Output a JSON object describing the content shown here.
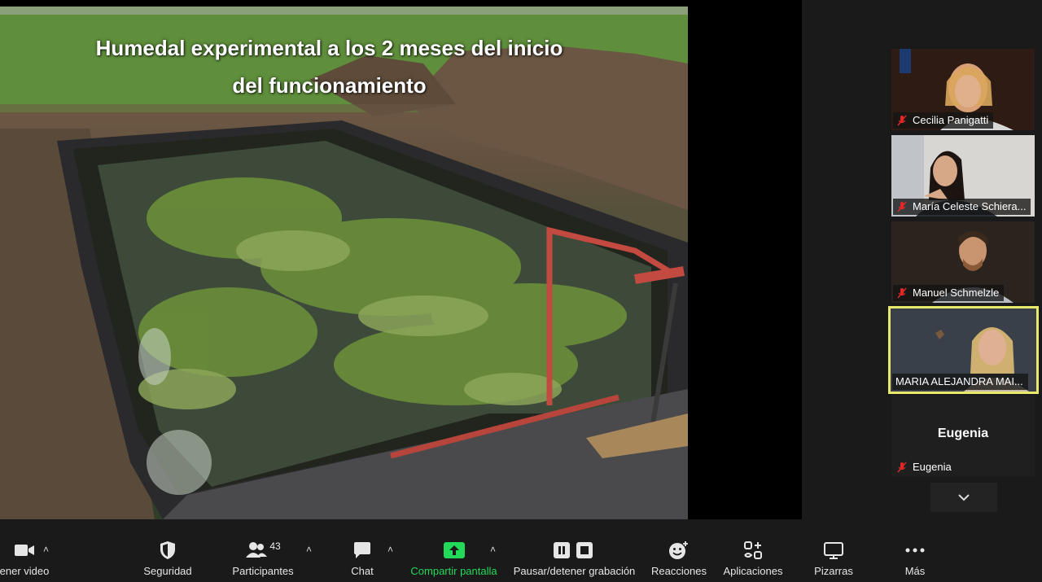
{
  "slide": {
    "title_line1": "Humedal experimental a los 2 meses del inicio",
    "title_line2": "del funcionamiento"
  },
  "participants": [
    {
      "name": "Cecilia Panigatti",
      "muted": true
    },
    {
      "name": "María Celeste Schiera...",
      "muted": true
    },
    {
      "name": "Manuel Schmelzle",
      "muted": true
    },
    {
      "name": "MARIA ALEJANDRA MAI...",
      "muted": false,
      "active_speaker": true
    },
    {
      "name": "Eugenia",
      "display": "Eugenia",
      "muted": true
    }
  ],
  "toolbar": {
    "video": "ener video",
    "security": "Seguridad",
    "participants": "Participantes",
    "participants_count": "43",
    "chat": "Chat",
    "share": "Compartir pantalla",
    "record": "Pausar/detener grabación",
    "reactions": "Reacciones",
    "apps": "Aplicaciones",
    "whiteboards": "Pizarras",
    "more": "Más"
  },
  "colors": {
    "share_green": "#23d959",
    "active_border": "#e8e86a",
    "muted_red": "#e02828"
  }
}
